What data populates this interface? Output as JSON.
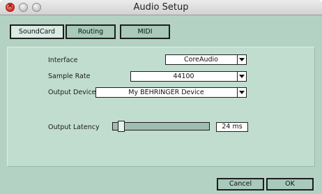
{
  "window": {
    "title": "Audio Setup"
  },
  "tabs": [
    {
      "label": "SoundCard",
      "active": true
    },
    {
      "label": "Routing",
      "active": false
    },
    {
      "label": "MIDI",
      "active": false
    }
  ],
  "settings": {
    "interface": {
      "label": "Interface",
      "value": "CoreAudio"
    },
    "sample_rate": {
      "label": "Sample Rate",
      "value": "44100"
    },
    "output_device": {
      "label": "Output Device",
      "value": "My BEHRINGER Device"
    },
    "output_latency": {
      "label": "Output Latency",
      "value": "24 ms",
      "slider_fraction": 0.04
    }
  },
  "buttons": {
    "cancel": "Cancel",
    "ok": "OK"
  },
  "colors": {
    "window_bg": "#b3d2c4",
    "panel_bg": "#c1ddd0",
    "active_tab": "#d9ebe3",
    "close_button": "#d8281c"
  },
  "icons": [
    "close-icon",
    "minimize-icon",
    "zoom-icon",
    "dropdown-arrow-icon"
  ]
}
